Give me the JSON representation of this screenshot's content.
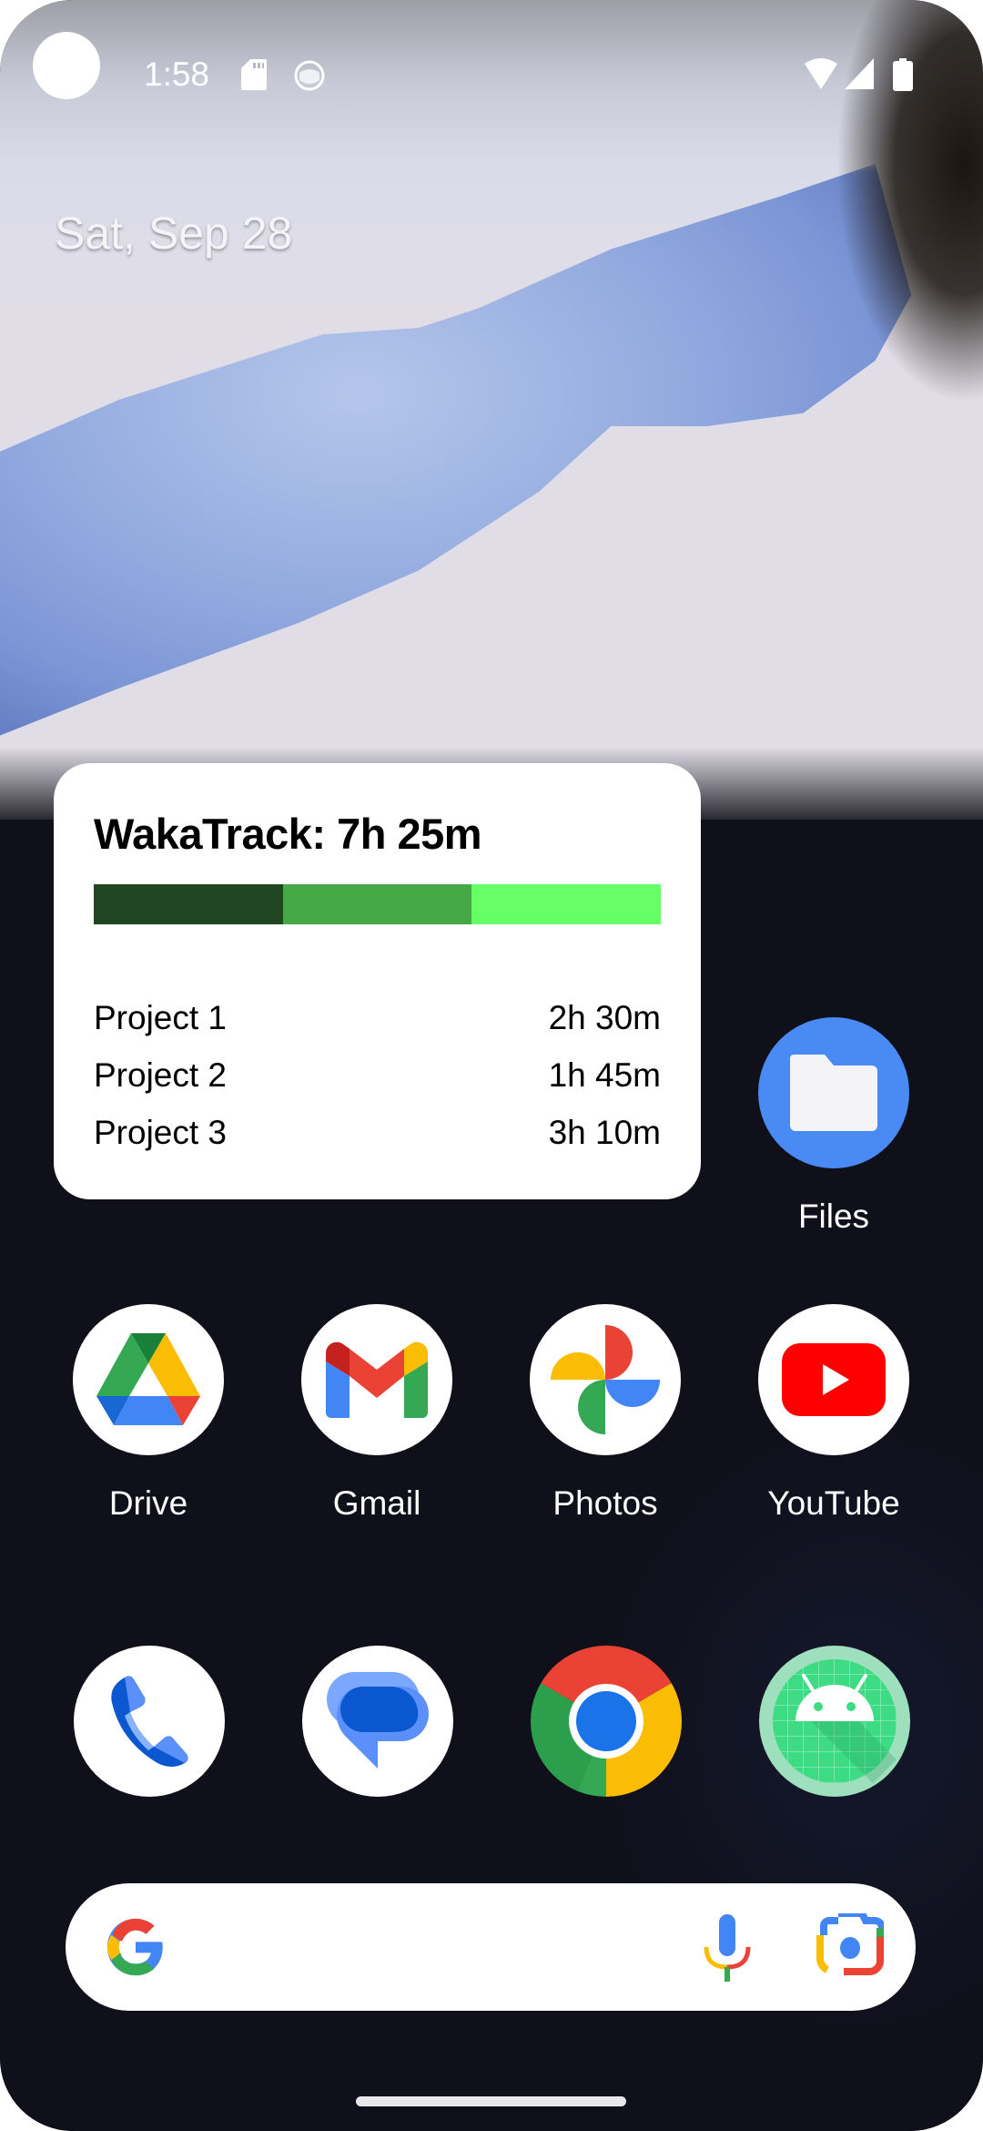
{
  "status_bar": {
    "time": "1:58",
    "left_icons": [
      "camera-cutout",
      "sd-card-icon",
      "android-notification-icon"
    ],
    "right_icons": [
      "wifi-icon",
      "cell-signal-icon",
      "battery-icon"
    ]
  },
  "date": "Sat, Sep 28",
  "widget": {
    "title": "WakaTrack: 7h 25m",
    "bar_segments": [
      {
        "project": "Project 1",
        "fraction": 0.3333,
        "color": "#1e4620"
      },
      {
        "project": "Project 2",
        "fraction": 0.3333,
        "color": "#45aa46"
      },
      {
        "project": "Project 3",
        "fraction": 0.3334,
        "color": "#66ff66"
      }
    ],
    "projects": [
      {
        "name": "Project 1",
        "time": "2h 30m"
      },
      {
        "name": "Project 2",
        "time": "1h 45m"
      },
      {
        "name": "Project 3",
        "time": "3h 10m"
      }
    ]
  },
  "apps": {
    "files": {
      "label": "Files",
      "icon": "folder-icon",
      "color": "#4a8af4"
    },
    "row1": [
      {
        "label": "Drive",
        "icon": "google-drive-icon"
      },
      {
        "label": "Gmail",
        "icon": "gmail-icon"
      },
      {
        "label": "Photos",
        "icon": "google-photos-icon"
      },
      {
        "label": "YouTube",
        "icon": "youtube-icon"
      }
    ],
    "dock": [
      {
        "label": "Phone",
        "icon": "phone-icon"
      },
      {
        "label": "Messages",
        "icon": "messages-icon"
      },
      {
        "label": "Chrome",
        "icon": "chrome-icon"
      },
      {
        "label": "Android app",
        "icon": "android-icon"
      }
    ]
  },
  "search_bar": {
    "icons": [
      "google-g-icon",
      "microphone-icon",
      "google-lens-icon"
    ]
  }
}
